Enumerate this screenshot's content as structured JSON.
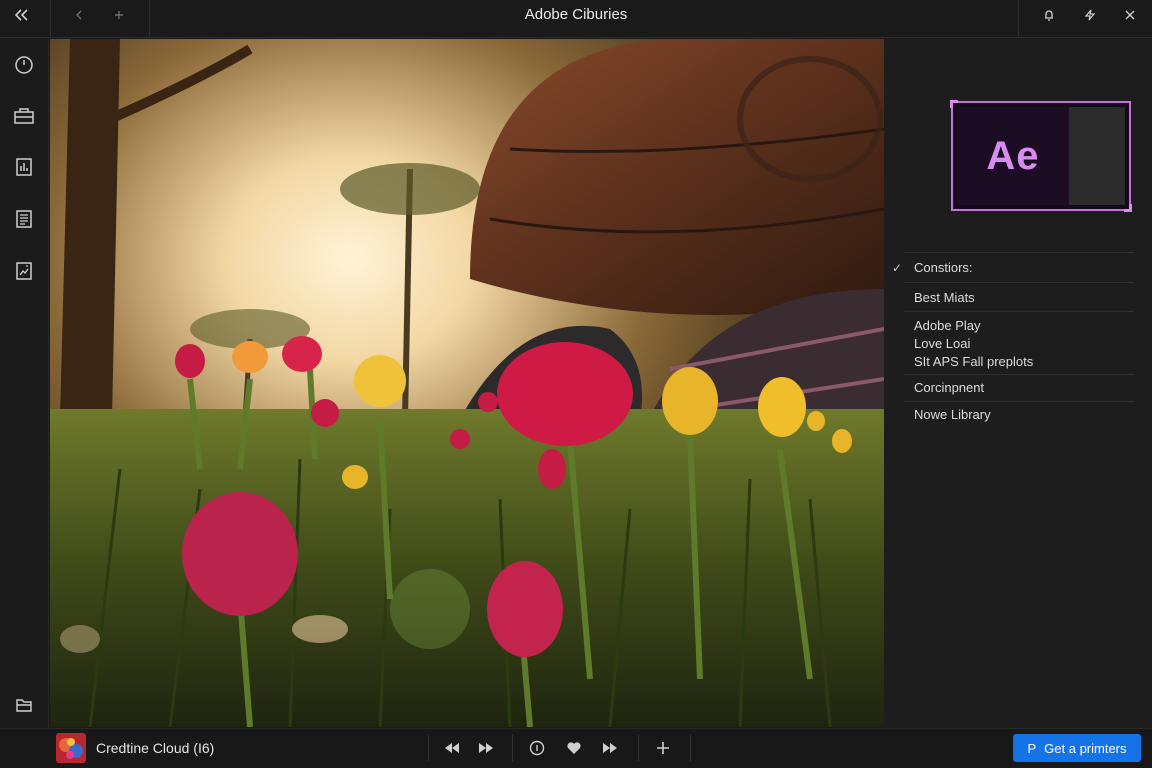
{
  "window": {
    "title": "Adobe Ciburies"
  },
  "titlebar": {
    "collapse_icon": "double-chevron-left-icon",
    "back_icon": "arrow-left-icon",
    "forward_icon": "plus-icon",
    "notification_icon": "bell-icon",
    "sync_icon": "sync-icon",
    "close_icon": "close-icon"
  },
  "rail": {
    "items": [
      {
        "name": "clock-icon"
      },
      {
        "name": "briefcase-icon"
      },
      {
        "name": "document-chart-icon"
      },
      {
        "name": "list-document-icon"
      },
      {
        "name": "image-document-icon"
      }
    ],
    "bottom_items": [
      {
        "name": "folder-icon"
      },
      {
        "name": "comment-icon"
      }
    ]
  },
  "panel": {
    "thumbnail_label": "Ae",
    "accent_color": "#c86ee0",
    "menu": [
      {
        "lines": [
          "Constiors:"
        ],
        "checked": true
      },
      {
        "lines": [
          "Best Miats"
        ],
        "checked": false
      },
      {
        "lines": [
          "Adobe Play",
          "Love Loai",
          "SIt APS Fall preplots"
        ],
        "checked": false
      },
      {
        "lines": [
          "Corcinpnent"
        ],
        "checked": false
      },
      {
        "lines": [
          "Nowe Library"
        ],
        "checked": false
      }
    ]
  },
  "bottombar": {
    "app_name": "Credtine Cloud (I6)",
    "controls": [
      "rewind-icon",
      "fast-forward-icon",
      "info-circle-icon",
      "heart-icon",
      "skip-forward-icon",
      "plus-icon"
    ],
    "cta_icon": "P",
    "cta_label": "Get a primters",
    "cta_color": "#1473e6"
  }
}
